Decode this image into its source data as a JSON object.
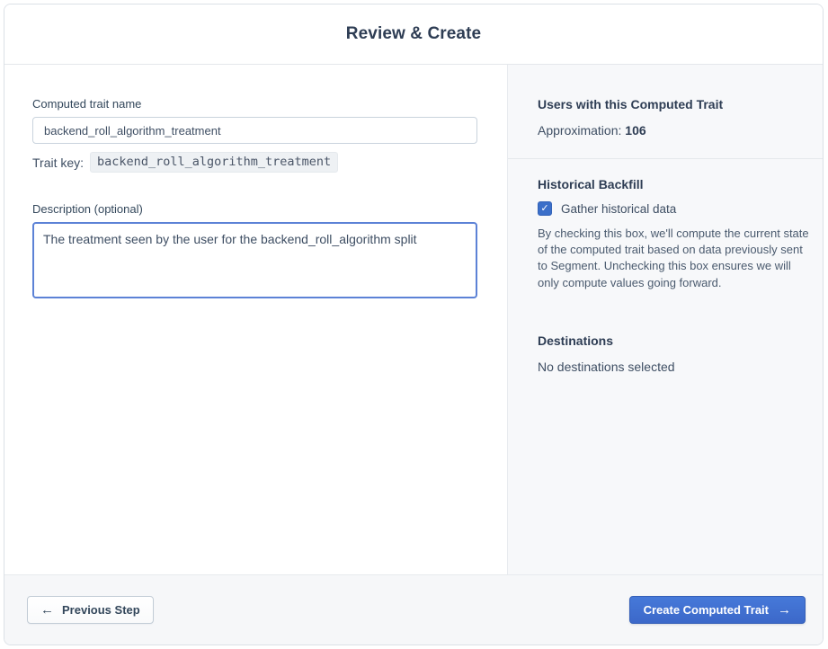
{
  "header": {
    "title": "Review & Create"
  },
  "form": {
    "name_label": "Computed trait name",
    "name_value": "backend_roll_algorithm_treatment",
    "trait_key_label": "Trait key:",
    "trait_key_value": "backend_roll_algorithm_treatment",
    "description_label": "Description (optional)",
    "description_value": "The treatment seen by the user for the backend_roll_algorithm split"
  },
  "summary": {
    "users_heading": "Users with this Computed Trait",
    "approximation_label": "Approximation: ",
    "approximation_value": "106",
    "backfill_heading": "Historical Backfill",
    "backfill_checkbox_label": "Gather historical data",
    "backfill_checkbox_checked": "true",
    "backfill_description": "By checking this box, we'll compute the current state of the computed trait based on data previously sent to Segment. Unchecking this box ensures we will only compute values going forward.",
    "destinations_heading": "Destinations",
    "destinations_value": "No destinations selected"
  },
  "footer": {
    "previous_label": "Previous Step",
    "create_label": "Create Computed Trait"
  },
  "icons": {
    "back_arrow": "←",
    "forward_arrow": "→",
    "checkmark": "✓"
  },
  "colors": {
    "primary_blue": "#3c68c9",
    "checkbox_blue": "#3b6fc9",
    "heading_navy": "#2e3d54",
    "body_text": "#3e4e63",
    "right_panel_bg": "#f7f8fa",
    "footer_bg": "#f6f7f9"
  }
}
